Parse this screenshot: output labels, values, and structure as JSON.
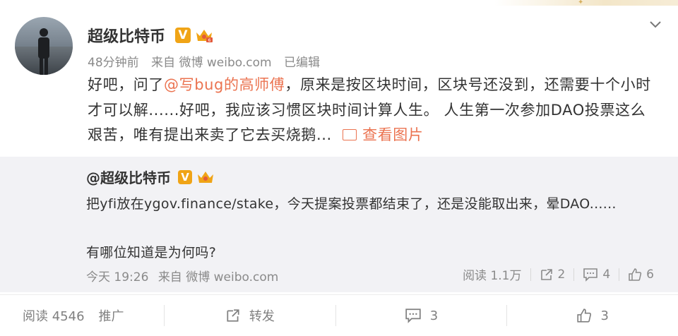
{
  "author": {
    "name": "超级比特币",
    "verified_badge": "V"
  },
  "meta": {
    "time": "48分钟前",
    "source": "来自 微博 weibo.com",
    "edited": "已编辑"
  },
  "post": {
    "text_1": "好吧，问了",
    "mention": "@写bug的高师傅",
    "text_2": "，原来是按区块时间，区块号还没到，还需要十个小时才可以解......好吧，我应该习惯区块时间计算人生。 人生第一次参加DAO投票这么艰苦，唯有提出来卖了它去买烧鹅...",
    "view_image": "查看图片"
  },
  "repost": {
    "author": "@超级比特币",
    "text_line1": "把yfi放在ygov.finance/stake，今天提案投票都结束了，还是没能取出来，晕DAO......",
    "text_line2": "有哪位知道是为何吗?",
    "time": "今天 19:26",
    "source": "来自 微博 weibo.com",
    "reads": "阅读 1.1万",
    "reposts": "2",
    "comments": "4",
    "likes": "6"
  },
  "footer": {
    "reads": "阅读 4546",
    "promote": "推广",
    "repost_label": "转发",
    "comments": "3",
    "likes": "3"
  },
  "colors": {
    "accent": "#eb7350",
    "badge": "#f0a416",
    "muted": "#8a8a8a",
    "repost_bg": "#f2f2f5"
  }
}
